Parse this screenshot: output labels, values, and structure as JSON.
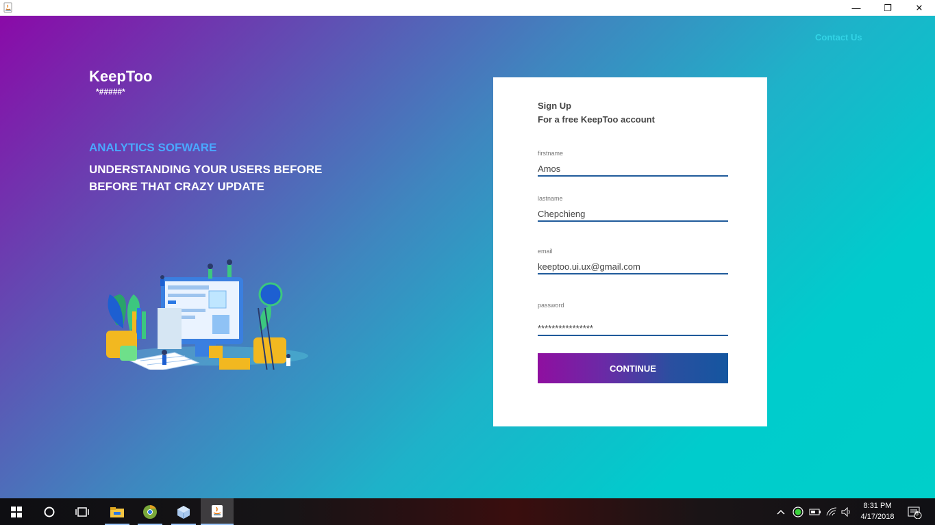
{
  "window": {
    "title_icon": "java-icon",
    "minimize": "—",
    "maximize": "❐",
    "close": "✕"
  },
  "header": {
    "contact_label": "Contact Us"
  },
  "brand": {
    "name": "KeepToo",
    "subtitle": "*#####*"
  },
  "hero": {
    "tagline": "ANALYTICS SOFWARE",
    "headline": "UNDERSTANDING YOUR USERS BEFORE BEFORE THAT CRAZY UPDATE"
  },
  "signup": {
    "title": "Sign Up",
    "subtitle": "For a free KeepToo account",
    "fields": {
      "firstname": {
        "label": "firstname",
        "value": "Amos"
      },
      "lastname": {
        "label": "lastname",
        "value": "Chepchieng"
      },
      "email": {
        "label": "email",
        "value": "keeptoo.ui.ux@gmail.com"
      },
      "password": {
        "label": "password",
        "value": "****************"
      }
    },
    "continue_label": "CONTINUE"
  },
  "taskbar": {
    "items": [
      "windows-start-icon",
      "cortana-search-icon",
      "task-view-icon",
      "file-explorer-icon",
      "chrome-icon",
      "virtualbox-icon",
      "java-app-icon"
    ],
    "time": "8:31 PM",
    "date": "4/17/2018",
    "notification_count": "8"
  },
  "colors": {
    "gradient_start": "#8a0aa8",
    "gradient_end": "#00cfca",
    "accent_blue": "#4aa8ff",
    "field_underline": "#1f5a9a",
    "contact": "#33d4e6"
  }
}
